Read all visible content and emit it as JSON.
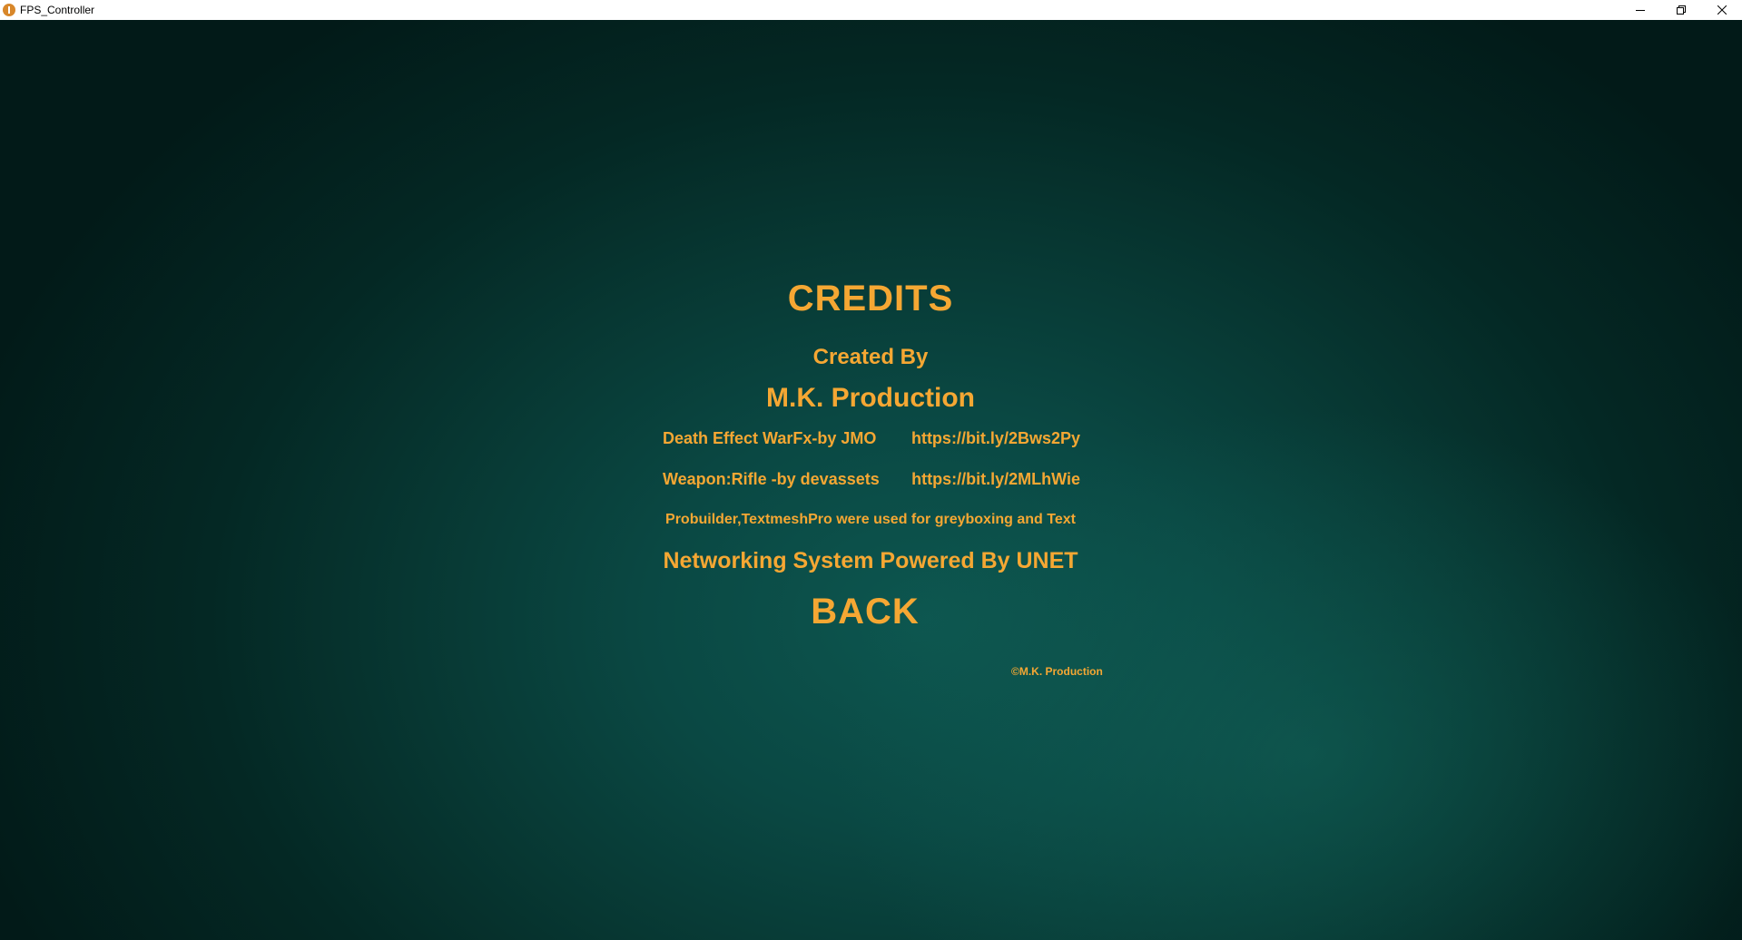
{
  "window": {
    "title": "FPS_Controller",
    "controls": {
      "minimize_icon": "minimize-icon",
      "restore_icon": "restore-icon",
      "close_icon": "close-icon"
    }
  },
  "colors": {
    "text_accent": "#f5a733",
    "background_dark": "#021a18",
    "background_glow": "#0d564f",
    "titlebar": "#ffffff"
  },
  "credits": {
    "heading": "CREDITS",
    "created_by_label": "Created By",
    "studio_name": "M.K. Production",
    "assets": [
      {
        "name": "Death Effect WarFx-by JMO",
        "link": "https://bit.ly/2Bws2Py"
      },
      {
        "name": "Weapon:Rifle -by devassets",
        "link": "https://bit.ly/2MLhWie"
      }
    ],
    "tools_note": "Probuilder,TextmeshPro were used for greyboxing and Text",
    "networking_note": "Networking System Powered By UNET",
    "back_label": "BACK",
    "copyright": "©M.K. Production"
  }
}
